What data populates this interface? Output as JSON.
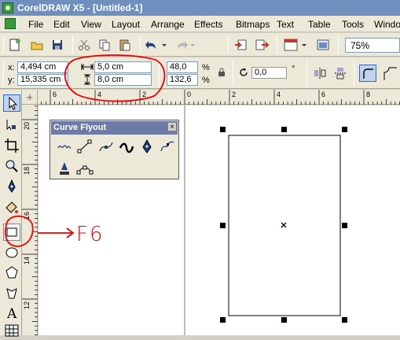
{
  "window": {
    "title": "CorelDRAW X5 - [Untitled-1]"
  },
  "menu": [
    "File",
    "Edit",
    "View",
    "Layout",
    "Arrange",
    "Effects",
    "Bitmaps",
    "Text",
    "Table",
    "Tools",
    "Windo"
  ],
  "zoom": "75%",
  "position": {
    "x_label": "x:",
    "x": "4,494 cm",
    "y_label": "y:",
    "y": "15,335 cm"
  },
  "size": {
    "width": "5,0 cm",
    "height": "8,0 cm"
  },
  "scale": {
    "x": "48,0",
    "y": "132,6",
    "unit": "%"
  },
  "rotation": {
    "value": "0,0",
    "unit": "°"
  },
  "ruler_top": {
    "ticks": [
      "6",
      "4",
      "2",
      "0",
      "2",
      "4",
      "6",
      "8"
    ]
  },
  "ruler_left": {
    "ticks": [
      "20",
      "18",
      "16",
      "14",
      "12"
    ]
  },
  "flyout": {
    "title": "Curve Flyout",
    "close": "×"
  },
  "annotation": {
    "label": "F6"
  },
  "icons": [
    "new-icon",
    "open-icon",
    "save-icon",
    "cut-icon",
    "copy-icon",
    "paste-icon",
    "undo-icon",
    "redo-icon",
    "import-icon",
    "export-icon",
    "publish-icon",
    "app-launcher-icon",
    "lock-icon",
    "rotate-icon",
    "mirror-h-icon",
    "mirror-v-icon",
    "pick-tool-icon",
    "shape-tool-icon",
    "crop-tool-icon",
    "zoom-tool-icon",
    "freehand-tool-icon",
    "smart-fill-icon",
    "rectangle-tool-icon",
    "ellipse-tool-icon",
    "polygon-tool-icon",
    "basic-shapes-icon",
    "text-tool-icon",
    "table-tool-icon"
  ]
}
